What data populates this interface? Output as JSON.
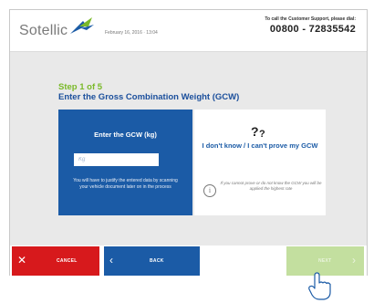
{
  "header": {
    "logo_text": "Sotellic",
    "date": "February 16, 2016 · 13:04",
    "support_text": "To call the Customer Support, please dial:",
    "support_phone": "00800 - 72835542"
  },
  "main": {
    "step": "Step 1 of 5",
    "question": "Enter the Gross Combination Weight (GCW)",
    "enter_card": {
      "title": "Enter the GCW (kg)",
      "input_placeholder": "Kg",
      "input_value": "",
      "note": "You will have to justify the entered data by scanning your vehicle document later on in the process"
    },
    "unknown_card": {
      "icon": "question-marks-icon",
      "label": "I don't know / I can't prove my GCW",
      "info_icon": "info-icon",
      "info_text": "If you cannot prove or do not know the GCW you will be applied the highest rate"
    }
  },
  "footer": {
    "cancel_label": "CANCEL",
    "back_label": "BACK",
    "next_label": "NEXT"
  },
  "colors": {
    "blue": "#1b5ba6",
    "green": "#7ab929",
    "red": "#d7191c",
    "next_disabled": "#c3df9f"
  }
}
